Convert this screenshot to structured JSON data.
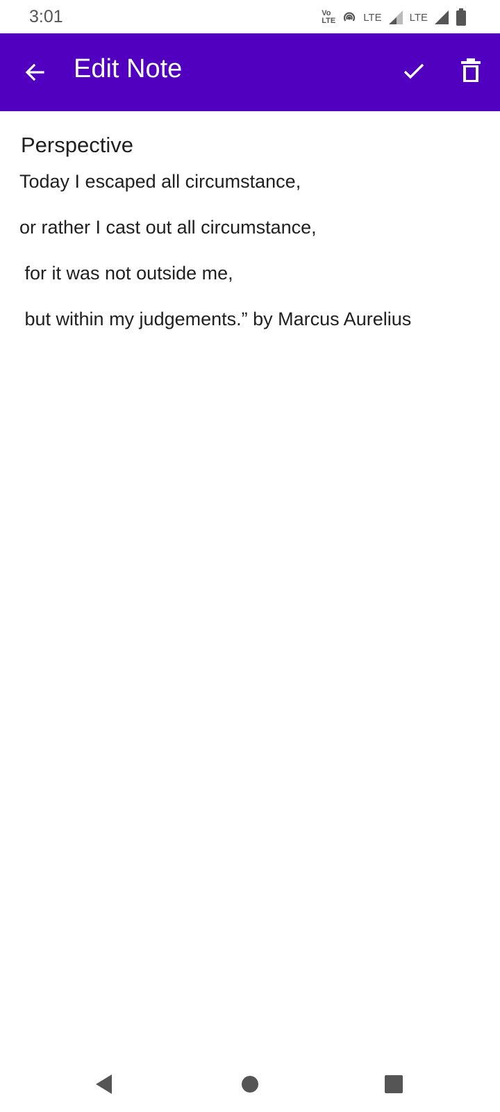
{
  "status_bar": {
    "time": "3:01",
    "volte_top": "Vo",
    "volte_bottom": "LTE",
    "lte1": "LTE",
    "lte2": "LTE",
    "icons": [
      "volte-icon",
      "hotspot-icon",
      "signal-icon",
      "signal-icon",
      "battery-icon"
    ]
  },
  "app_bar": {
    "title": "Edit Note",
    "background_color": "#5000be",
    "icons": [
      "back-arrow-icon",
      "check-icon",
      "trash-icon"
    ]
  },
  "note": {
    "title": "Perspective",
    "lines": [
      "Today I escaped all circumstance,",
      "or rather I cast out all circumstance,",
      " for it was not outside me,",
      " but within my judgements.” by Marcus Aurelius"
    ]
  },
  "nav_bar": {
    "icons": [
      "back-triangle-icon",
      "home-circle-icon",
      "recents-square-icon"
    ]
  }
}
